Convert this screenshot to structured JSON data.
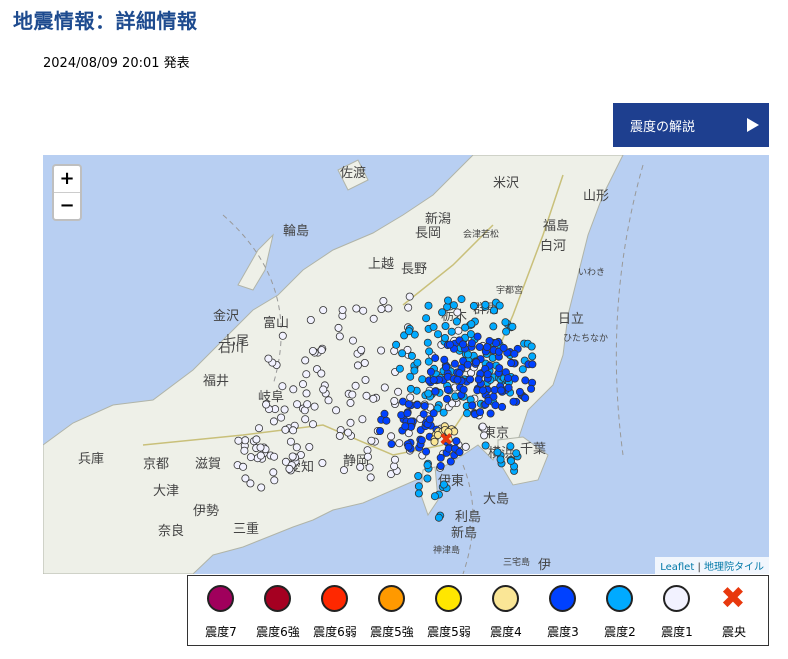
{
  "header": {
    "title": "地震情報：詳細情報",
    "issued": "2024/08/09 20:01 発表"
  },
  "explain_button": {
    "label": "震度の解説"
  },
  "map": {
    "zoom_in": "+",
    "zoom_out": "−",
    "attribution": {
      "leaflet": "Leaflet",
      "separator": "|",
      "tiles": "地理院タイル"
    },
    "place_labels": [
      "佐渡",
      "新潟",
      "長岡",
      "福島",
      "会津若松",
      "米沢",
      "山形",
      "白河",
      "いわき",
      "日立",
      "ひたちなか",
      "宇都宮",
      "栃木",
      "群馬",
      "長野",
      "上越",
      "富山",
      "金沢",
      "石川",
      "福井",
      "岐阜",
      "愛知",
      "静岡",
      "三重",
      "奈良",
      "兵庫",
      "京都",
      "滋賀",
      "千葉",
      "横浜",
      "東京",
      "大島",
      "伊東",
      "三宅島",
      "神津島",
      "輪島",
      "七尾",
      "大津",
      "伊勢",
      "利島",
      "新島",
      "伊"
    ]
  },
  "legend": [
    {
      "label": "震度7",
      "color": "#a0005c"
    },
    {
      "label": "震度6強",
      "color": "#a50021"
    },
    {
      "label": "震度6弱",
      "color": "#ff2800"
    },
    {
      "label": "震度5強",
      "color": "#ff9900"
    },
    {
      "label": "震度5弱",
      "color": "#ffe600"
    },
    {
      "label": "震度4",
      "color": "#fae696"
    },
    {
      "label": "震度3",
      "color": "#0041ff"
    },
    {
      "label": "震度2",
      "color": "#00aaff"
    },
    {
      "label": "震度1",
      "color": "#f2f2ff"
    },
    {
      "label": "震央",
      "color": "#e8380d",
      "icon": "epicenter-cross"
    }
  ],
  "epicenter_symbol": "✖"
}
